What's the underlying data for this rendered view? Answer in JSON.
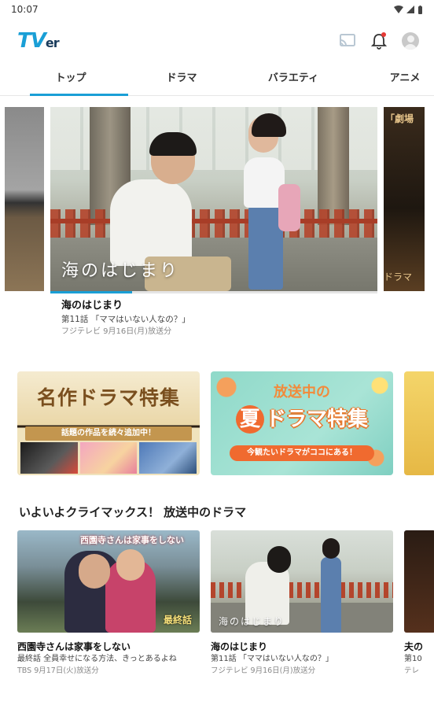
{
  "status_bar": {
    "time": "10:07",
    "icons": "▾◢▮"
  },
  "header": {
    "logo_main": "TV",
    "logo_suffix": "er",
    "cast_icon": "cast-icon",
    "bell_icon": "bell-icon",
    "avatar_icon": "avatar-icon",
    "accent_color": "#1a9fd6",
    "notification_dot_color": "#e53935"
  },
  "tabs": [
    {
      "label": "トップ",
      "active": true
    },
    {
      "label": "ドラマ",
      "active": false
    },
    {
      "label": "バラエティ",
      "active": false
    },
    {
      "label": "アニメ",
      "active": false
    }
  ],
  "hero": {
    "caption": "海のはじまり",
    "next_tag": "「劇場",
    "next_tag2": "ドラマ",
    "progress": 0.25,
    "title": "海のはじまり",
    "episode": "第11話 「ママはいない人なの？」",
    "meta": "フジテレビ 9月16日(月)放送分"
  },
  "promos": [
    {
      "title": "名作ドラマ特集",
      "subtitle": "話題の作品を続々追加中！"
    },
    {
      "top": "放送中の",
      "summer": "夏",
      "main": "ドラマ特集",
      "subtitle": "今観たいドラマがココにある！"
    }
  ],
  "section": {
    "title": "いよいよクライマックス！ 放送中のドラマ",
    "cards": [
      {
        "thumb_title": "西園寺さんは家事をしない",
        "thumb_badge": "最終話",
        "title": "西園寺さんは家事をしない",
        "subtitle": "最終話 全員幸せになる方法、きっとあるよね",
        "meta": "TBS 9月17日(火)放送分"
      },
      {
        "thumb_caption": "海のはじまり",
        "title": "海のはじまり",
        "subtitle": "第11話 「ママはいない人なの？」",
        "meta": "フジテレビ 9月16日(月)放送分"
      },
      {
        "title": "夫の",
        "subtitle": "第10",
        "meta": "テレ"
      }
    ]
  }
}
